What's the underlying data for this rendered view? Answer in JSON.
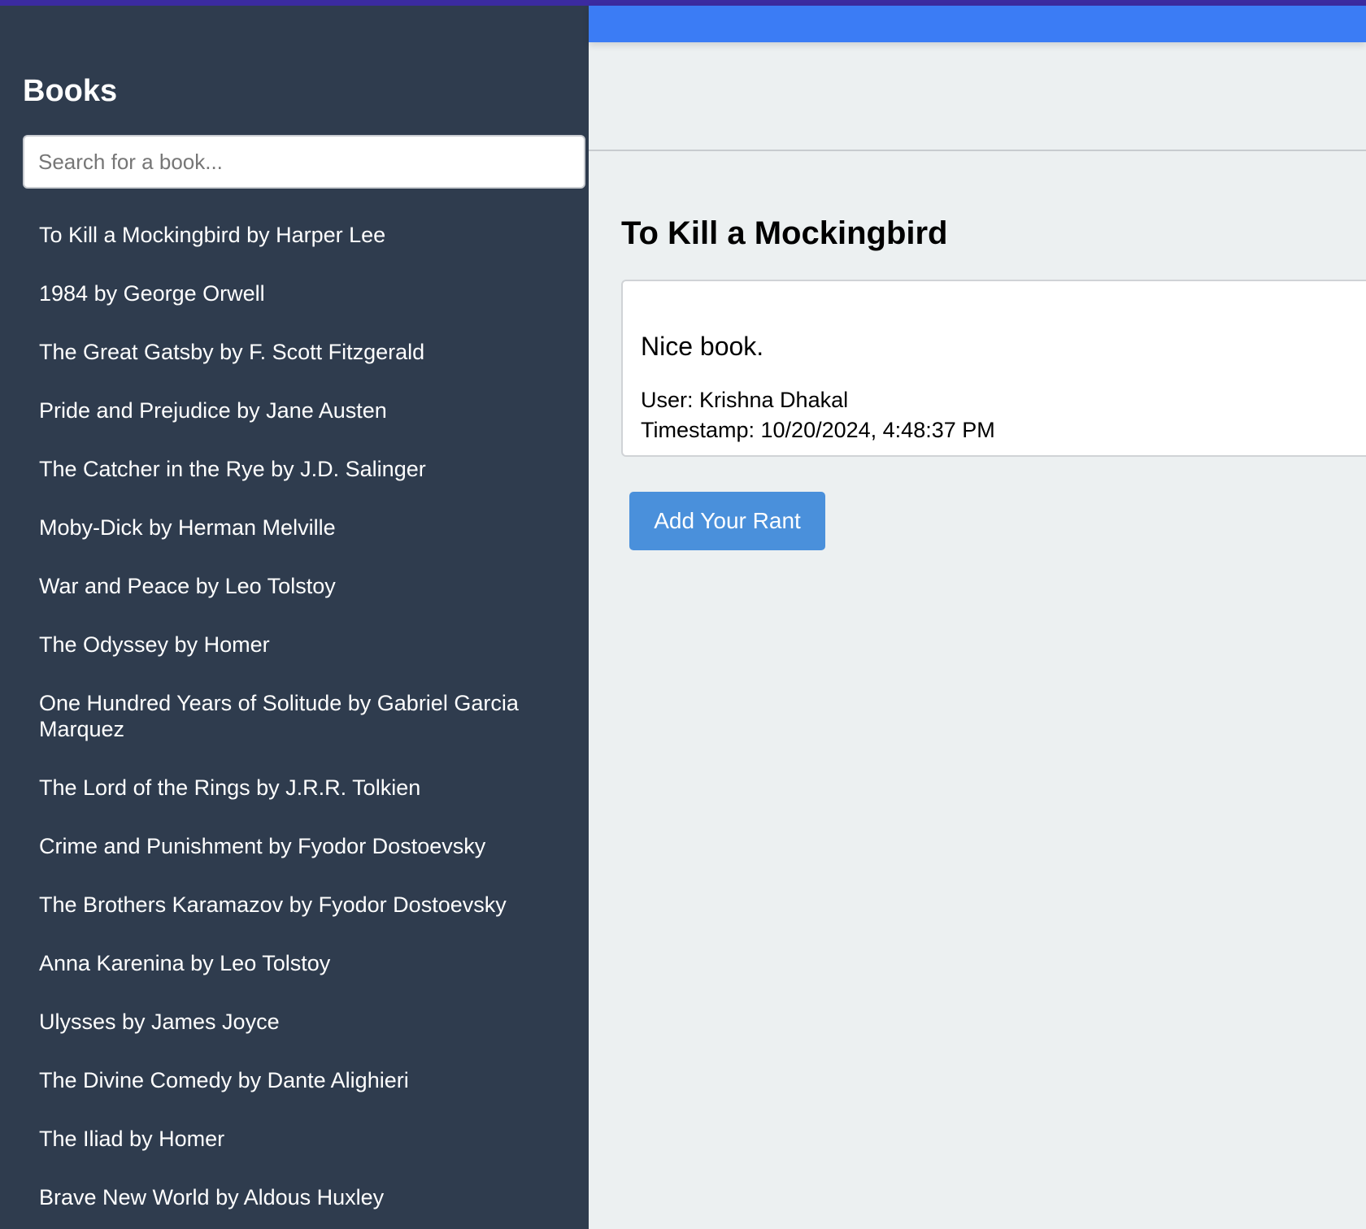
{
  "colors": {
    "sidebar_bg": "#2f3c4e",
    "header_bar": "#3b7cf5",
    "main_bg": "#ecf0f1",
    "button_bg": "#4a90db"
  },
  "sidebar": {
    "title": "Books",
    "search": {
      "placeholder": "Search for a book...",
      "value": ""
    },
    "books": [
      "To Kill a Mockingbird by Harper Lee",
      "1984 by George Orwell",
      "The Great Gatsby by F. Scott Fitzgerald",
      "Pride and Prejudice by Jane Austen",
      "The Catcher in the Rye by J.D. Salinger",
      "Moby-Dick by Herman Melville",
      "War and Peace by Leo Tolstoy",
      "The Odyssey by Homer",
      "One Hundred Years of Solitude by Gabriel Garcia Marquez",
      "The Lord of the Rings by J.R.R. Tolkien",
      "Crime and Punishment by Fyodor Dostoevsky",
      "The Brothers Karamazov by Fyodor Dostoevsky",
      "Anna Karenina by Leo Tolstoy",
      "Ulysses by James Joyce",
      "The Divine Comedy by Dante Alighieri",
      "The Iliad by Homer",
      "Brave New World by Aldous Huxley"
    ]
  },
  "main": {
    "book_title": "To Kill a Mockingbird",
    "rant": {
      "text": "Nice book.",
      "user": "User: Krishna Dhakal",
      "timestamp": "Timestamp: 10/20/2024, 4:48:37 PM"
    },
    "add_rant_label": "Add Your Rant"
  }
}
